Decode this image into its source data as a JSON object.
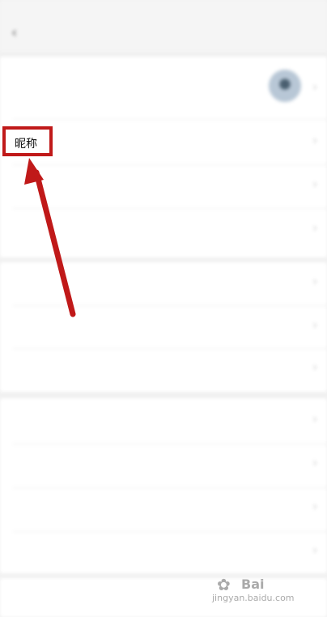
{
  "statusbar": {
    "time": "",
    "icons": ""
  },
  "header": {
    "back_icon": "chevron-left-icon",
    "title": ""
  },
  "rows": [
    {
      "label": "",
      "value": ""
    },
    {
      "label": "昵称",
      "value": ""
    },
    {
      "label": "",
      "value": ""
    },
    {
      "label": "",
      "value": ""
    },
    {
      "label": "",
      "value": ""
    },
    {
      "label": "",
      "value": ""
    },
    {
      "label": "",
      "value": ""
    },
    {
      "label": "",
      "value": ""
    },
    {
      "label": "",
      "value": ""
    },
    {
      "label": "",
      "value": ""
    },
    {
      "label": "",
      "value": ""
    },
    {
      "label": "",
      "value": ""
    }
  ],
  "highlight": {
    "text": "昵称",
    "color": "#c01919"
  },
  "watermark": {
    "text": "Bai",
    "url": "jingyan.baidu.com"
  },
  "colors": {
    "accent_red": "#e4583a",
    "highlight_red": "#c01919"
  }
}
